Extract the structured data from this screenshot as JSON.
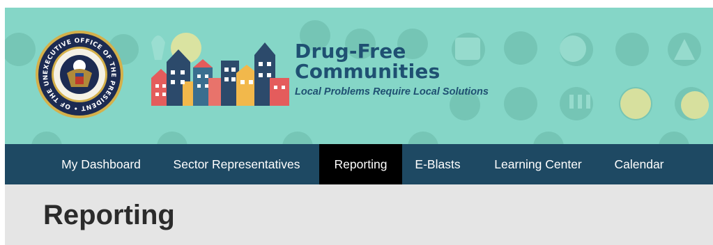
{
  "header": {
    "seal_text": "EXECUTIVE OFFICE OF THE PRESIDENT OF THE UNITED STATES",
    "brand_title_line1": "Drug-Free",
    "brand_title_line2": "Communities",
    "tagline": "Local Problems Require Local Solutions",
    "colors": {
      "banner": "#85d6c7",
      "brand_text": "#1f5072",
      "seal_navy": "#1c2b52",
      "seal_gold": "#d4b04a"
    }
  },
  "nav": {
    "items": [
      {
        "label": "My Dashboard",
        "active": false
      },
      {
        "label": "Sector Representatives",
        "active": false
      },
      {
        "label": "Reporting",
        "active": true
      },
      {
        "label": "E-Blasts",
        "active": false
      },
      {
        "label": "Learning Center",
        "active": false
      },
      {
        "label": "Calendar",
        "active": false
      }
    ],
    "colors": {
      "background": "#1e4963",
      "active": "#000000",
      "text": "#ffffff"
    }
  },
  "page": {
    "title": "Reporting"
  }
}
